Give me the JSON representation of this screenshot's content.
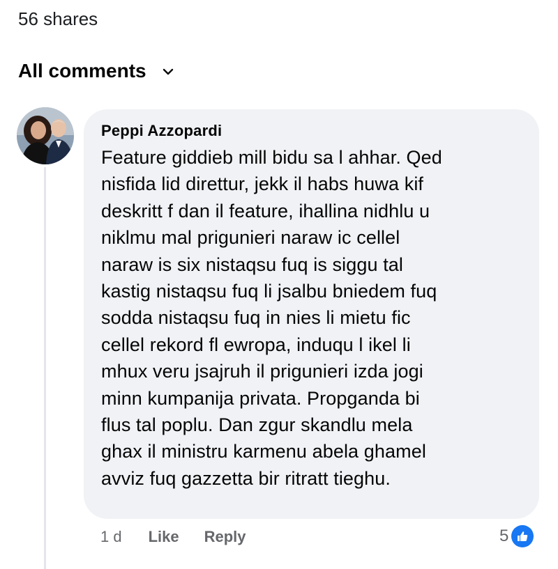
{
  "post": {
    "shares_label": "56 shares"
  },
  "comments_section": {
    "sort_label": "All comments",
    "sort_icon": "chevron-down-icon"
  },
  "comment": {
    "author": "Peppi Azzopardi",
    "text": "Feature giddieb mill bidu sa l ahhar.  Qed\nnisfida lid direttur, jekk il habs huwa kif\ndeskritt f dan il feature, ihallina nidhlu u\nniklmu mal prigunieri naraw ic cellel\nnaraw is six nistaqsu fuq is siggu tal\nkastig nistaqsu fuq li jsalbu bniedem fuq\nsodda nistaqsu fuq in nies li mietu  fic\ncellel rekord fl ewropa, induqu l ikel li\nmhux veru jsajruh il prigunieri izda jogi\nminn kumpanija privata. Propganda bi\nflus tal poplu. Dan zgur skandlu mela\nghax il ministru karmenu abela ghamel\navviz fuq gazzetta bir ritratt tieghu.",
    "time": "1 d",
    "like_label": "Like",
    "reply_label": "Reply",
    "reaction_count": "5",
    "reaction_icon": "thumbs-up-icon",
    "reaction_color": "#1877f2"
  }
}
